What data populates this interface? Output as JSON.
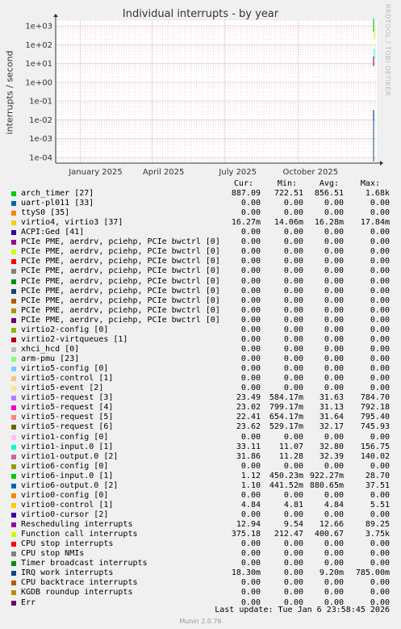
{
  "title": "Individual interrupts - by year",
  "side_text": "RRDTOOL / TOBI OETIKER",
  "footer": {
    "last_update": "Last update:  Tue Jan  6 23:58:45 2026",
    "version": "Munin 2.0.76"
  },
  "columns": {
    "cur": "Cur:",
    "min": "Min:",
    "avg": "Avg:",
    "max": "Max:"
  },
  "chart_data": {
    "type": "line",
    "title": "Individual interrupts - by year",
    "ylabel": "interrupts / second",
    "yscale": "log",
    "ylim": [
      5e-05,
      2000
    ],
    "yticks": [
      "1e-04",
      "1e-03",
      "1e-02",
      "1e-01",
      "1e+00",
      "1e+01",
      "1e+02",
      "1e+03"
    ],
    "xlim": [
      "2024-12-01",
      "2026-01-07"
    ],
    "xticks": [
      "January 2025",
      "April 2025",
      "July 2025",
      "October 2025"
    ],
    "grid": true,
    "series_spike_note_values": [
      {
        "name": "arch_timer [27]",
        "color": "#00cc00",
        "value": 887.09
      },
      {
        "name": "Function call interrupts",
        "color": "#ccff00",
        "value": 375.18
      },
      {
        "name": "Rescheduling interrupts",
        "color": "#990099",
        "value": 12.94
      },
      {
        "name": "virtio1-input.0 [1]",
        "color": "#33ffcc",
        "value": 33.11
      },
      {
        "name": "IRQ work interrupts",
        "color": "#004488",
        "value": 0.0183
      }
    ]
  },
  "legend": [
    {
      "label": "arch_timer [27]",
      "color": "#00cc00",
      "cur": "887.09",
      "min": "722.51",
      "avg": "856.51",
      "max": "1.68k"
    },
    {
      "label": "uart-pl011 [33]",
      "color": "#0066b3",
      "cur": "0.00",
      "min": "0.00",
      "avg": "0.00",
      "max": "0.00"
    },
    {
      "label": "ttyS0 [35]",
      "color": "#ff8000",
      "cur": "0.00",
      "min": "0.00",
      "avg": "0.00",
      "max": "0.00"
    },
    {
      "label": "virtio4, virtio3 [37]",
      "color": "#ffcc00",
      "cur": "16.27m",
      "min": "14.06m",
      "avg": "16.28m",
      "max": "17.84m"
    },
    {
      "label": "ACPI:Ged [41]",
      "color": "#330099",
      "cur": "0.00",
      "min": "0.00",
      "avg": "0.00",
      "max": "0.00"
    },
    {
      "label": "PCIe PME, aerdrv, pciehp, PCIe bwctrl [0]",
      "color": "#990099",
      "cur": "0.00",
      "min": "0.00",
      "avg": "0.00",
      "max": "0.00"
    },
    {
      "label": "PCIe PME, aerdrv, pciehp, PCIe bwctrl [0]",
      "color": "#ccff00",
      "cur": "0.00",
      "min": "0.00",
      "avg": "0.00",
      "max": "0.00"
    },
    {
      "label": "PCIe PME, aerdrv, pciehp, PCIe bwctrl [0]",
      "color": "#ff0000",
      "cur": "0.00",
      "min": "0.00",
      "avg": "0.00",
      "max": "0.00"
    },
    {
      "label": "PCIe PME, aerdrv, pciehp, PCIe bwctrl [0]",
      "color": "#808080",
      "cur": "0.00",
      "min": "0.00",
      "avg": "0.00",
      "max": "0.00"
    },
    {
      "label": "PCIe PME, aerdrv, pciehp, PCIe bwctrl [0]",
      "color": "#008f00",
      "cur": "0.00",
      "min": "0.00",
      "avg": "0.00",
      "max": "0.00"
    },
    {
      "label": "PCIe PME, aerdrv, pciehp, PCIe bwctrl [0]",
      "color": "#00487d",
      "cur": "0.00",
      "min": "0.00",
      "avg": "0.00",
      "max": "0.00"
    },
    {
      "label": "PCIe PME, aerdrv, pciehp, PCIe bwctrl [0]",
      "color": "#b35a00",
      "cur": "0.00",
      "min": "0.00",
      "avg": "0.00",
      "max": "0.00"
    },
    {
      "label": "PCIe PME, aerdrv, pciehp, PCIe bwctrl [0]",
      "color": "#b38f00",
      "cur": "0.00",
      "min": "0.00",
      "avg": "0.00",
      "max": "0.00"
    },
    {
      "label": "PCIe PME, aerdrv, pciehp, PCIe bwctrl [0]",
      "color": "#6b006b",
      "cur": "0.00",
      "min": "0.00",
      "avg": "0.00",
      "max": "0.00"
    },
    {
      "label": "virtio2-config [0]",
      "color": "#8fb300",
      "cur": "0.00",
      "min": "0.00",
      "avg": "0.00",
      "max": "0.00"
    },
    {
      "label": "virtio2-virtqueues [1]",
      "color": "#b30000",
      "cur": "0.00",
      "min": "0.00",
      "avg": "0.00",
      "max": "0.00"
    },
    {
      "label": "xhci_hcd [0]",
      "color": "#bebebe",
      "cur": "0.00",
      "min": "0.00",
      "avg": "0.00",
      "max": "0.00"
    },
    {
      "label": "arm-pmu [23]",
      "color": "#80ff80",
      "cur": "0.00",
      "min": "0.00",
      "avg": "0.00",
      "max": "0.00"
    },
    {
      "label": "virtio5-config [0]",
      "color": "#80c9ff",
      "cur": "0.00",
      "min": "0.00",
      "avg": "0.00",
      "max": "0.00"
    },
    {
      "label": "virtio5-control [1]",
      "color": "#ffc080",
      "cur": "0.00",
      "min": "0.00",
      "avg": "0.00",
      "max": "0.00"
    },
    {
      "label": "virtio5-event [2]",
      "color": "#ffe680",
      "cur": "0.00",
      "min": "0.00",
      "avg": "0.00",
      "max": "0.00"
    },
    {
      "label": "virtio5-request [3]",
      "color": "#aa80ff",
      "cur": "23.49",
      "min": "584.17m",
      "avg": "31.63",
      "max": "784.70"
    },
    {
      "label": "virtio5-request [4]",
      "color": "#ee00cc",
      "cur": "23.02",
      "min": "799.17m",
      "avg": "31.13",
      "max": "792.18"
    },
    {
      "label": "virtio5-request [5]",
      "color": "#ff8080",
      "cur": "22.41",
      "min": "654.17m",
      "avg": "31.64",
      "max": "795.40"
    },
    {
      "label": "virtio5-request [6]",
      "color": "#666600",
      "cur": "23.62",
      "min": "529.17m",
      "avg": "32.17",
      "max": "745.93"
    },
    {
      "label": "virtio1-config [0]",
      "color": "#ffbfff",
      "cur": "0.00",
      "min": "0.00",
      "avg": "0.00",
      "max": "0.00"
    },
    {
      "label": "virtio1-input.0 [1]",
      "color": "#00ffcc",
      "cur": "33.11",
      "min": "11.07",
      "avg": "32.80",
      "max": "156.75"
    },
    {
      "label": "virtio1-output.0 [2]",
      "color": "#cc6699",
      "cur": "31.86",
      "min": "11.28",
      "avg": "32.39",
      "max": "140.02"
    },
    {
      "label": "virtio6-config [0]",
      "color": "#999900",
      "cur": "0.00",
      "min": "0.00",
      "avg": "0.00",
      "max": "0.00"
    },
    {
      "label": "virtio6-input.0 [1]",
      "color": "#00cc00",
      "cur": "1.12",
      "min": "450.23m",
      "avg": "922.27m",
      "max": "28.70"
    },
    {
      "label": "virtio6-output.0 [2]",
      "color": "#0066b3",
      "cur": "1.10",
      "min": "441.52m",
      "avg": "880.65m",
      "max": "37.51"
    },
    {
      "label": "virtio0-config [0]",
      "color": "#ff8000",
      "cur": "0.00",
      "min": "0.00",
      "avg": "0.00",
      "max": "0.00"
    },
    {
      "label": "virtio0-control [1]",
      "color": "#ffcc00",
      "cur": "4.84",
      "min": "4.81",
      "avg": "4.84",
      "max": "5.51"
    },
    {
      "label": "virtio0-cursor [2]",
      "color": "#330099",
      "cur": "0.00",
      "min": "0.00",
      "avg": "0.00",
      "max": "0.00"
    },
    {
      "label": "Rescheduling interrupts",
      "color": "#990099",
      "cur": "12.94",
      "min": "9.54",
      "avg": "12.66",
      "max": "89.25"
    },
    {
      "label": "Function call interrupts",
      "color": "#ccff00",
      "cur": "375.18",
      "min": "212.47",
      "avg": "400.67",
      "max": "3.75k"
    },
    {
      "label": "CPU stop interrupts",
      "color": "#ff0000",
      "cur": "0.00",
      "min": "0.00",
      "avg": "0.00",
      "max": "0.00"
    },
    {
      "label": "CPU stop NMIs",
      "color": "#808080",
      "cur": "0.00",
      "min": "0.00",
      "avg": "0.00",
      "max": "0.00"
    },
    {
      "label": "Timer broadcast interrupts",
      "color": "#008f00",
      "cur": "0.00",
      "min": "0.00",
      "avg": "0.00",
      "max": "0.00"
    },
    {
      "label": "IRQ work interrupts",
      "color": "#00487d",
      "cur": "18.30m",
      "min": "0.00",
      "avg": "9.20m",
      "max": "785.00m"
    },
    {
      "label": "CPU backtrace interrupts",
      "color": "#b35a00",
      "cur": "0.00",
      "min": "0.00",
      "avg": "0.00",
      "max": "0.00"
    },
    {
      "label": "KGDB roundup interrupts",
      "color": "#b38f00",
      "cur": "0.00",
      "min": "0.00",
      "avg": "0.00",
      "max": "0.00"
    },
    {
      "label": "Err",
      "color": "#6b006b",
      "cur": "0.00",
      "min": "0.00",
      "avg": "0.00",
      "max": "0.00"
    }
  ]
}
